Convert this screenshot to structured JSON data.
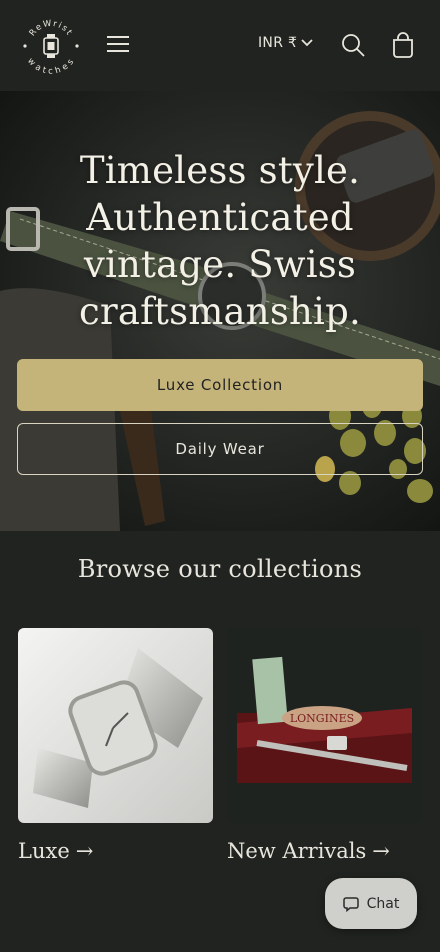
{
  "header": {
    "logo_text_top": "ReWrist",
    "logo_text_bottom": "watches",
    "currency": "INR ₹",
    "icons": [
      "menu-icon",
      "chevron-down-icon",
      "search-icon",
      "cart-icon"
    ]
  },
  "hero": {
    "title": "Timeless style. Authenticated vintage. Swiss craftsmanship.",
    "primary_button": "Luxe Collection",
    "secondary_button": "Daily Wear"
  },
  "collections": {
    "title": "Browse our collections",
    "items": [
      {
        "label": "Luxe"
      },
      {
        "label": "New Arrivals",
        "box_brand": "LONGINES"
      }
    ]
  },
  "chat": {
    "label": "Chat"
  },
  "colors": {
    "background": "#202320",
    "accent": "#c4b47a",
    "text": "#e8e6dc",
    "chat_bg": "#cfcfcb"
  }
}
